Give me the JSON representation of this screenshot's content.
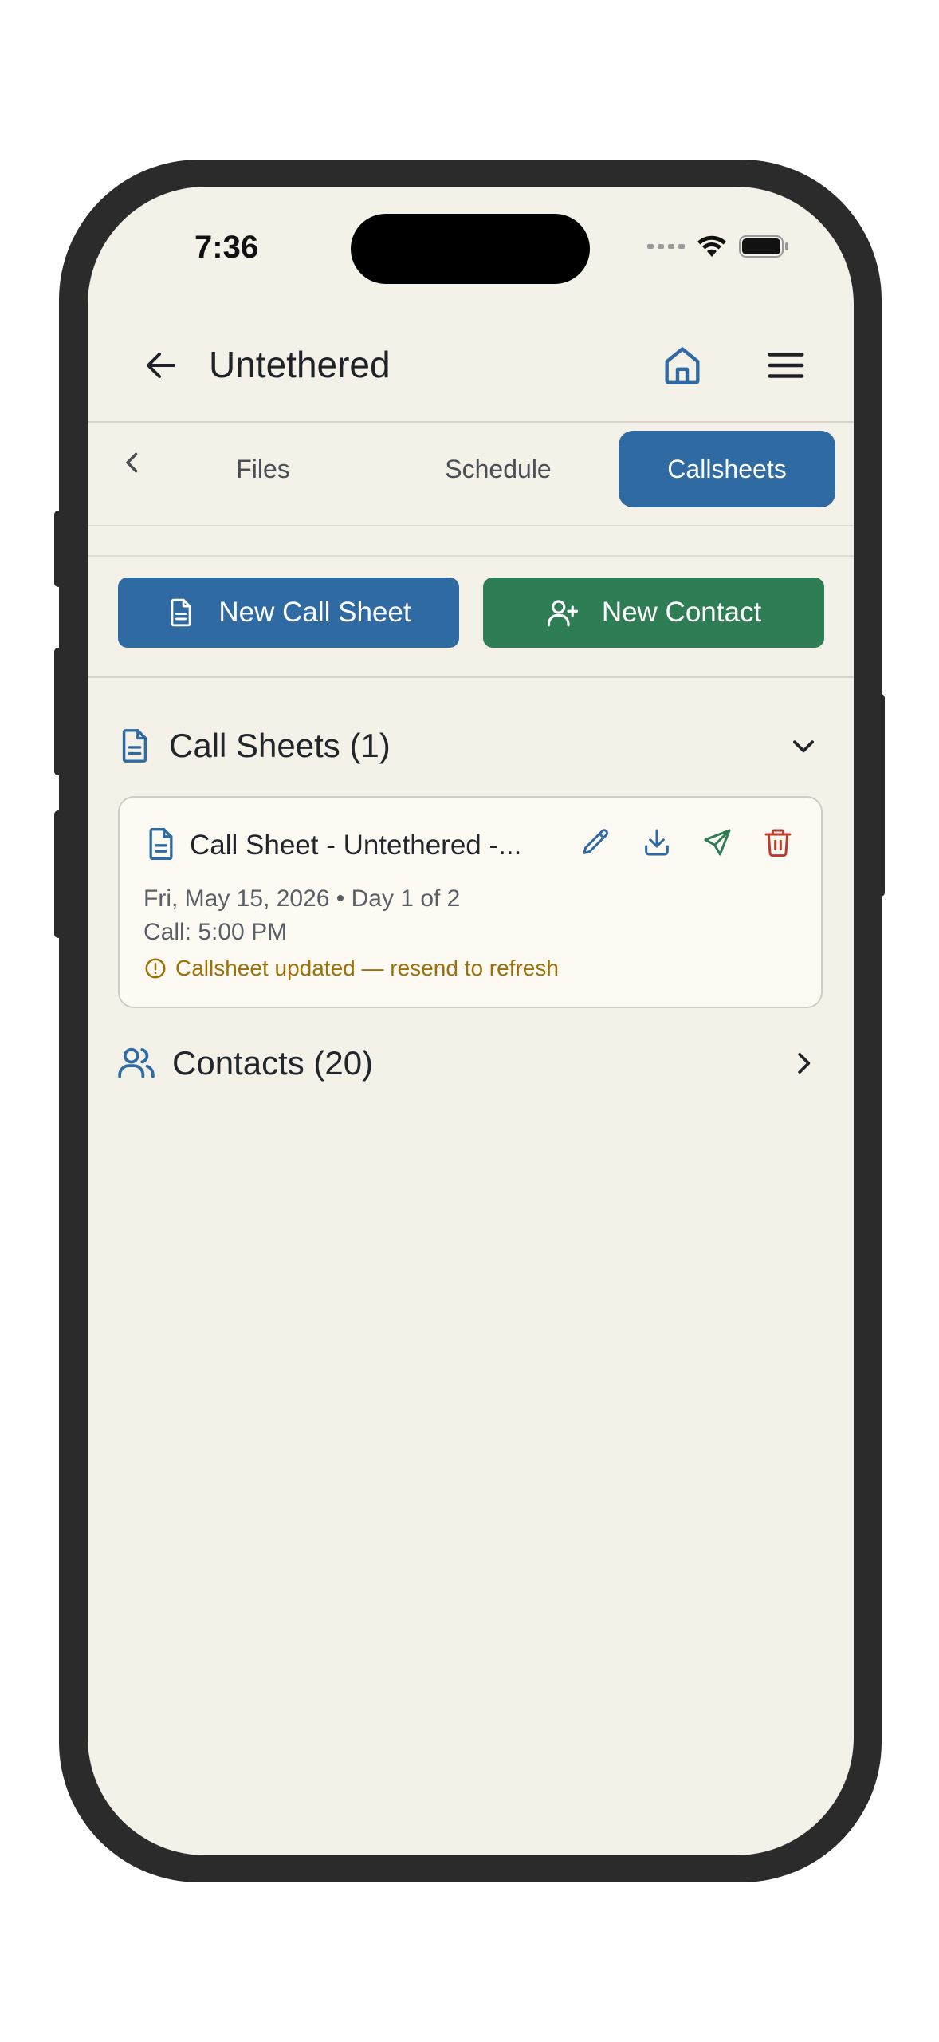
{
  "status_bar": {
    "time": "7:36"
  },
  "app_bar": {
    "title": "Untethered"
  },
  "tabs": [
    {
      "label": "Files"
    },
    {
      "label": "Schedule"
    },
    {
      "label": "Callsheets"
    }
  ],
  "actions": {
    "new_call_sheet": "New Call Sheet",
    "new_contact": "New Contact"
  },
  "call_sheets_section": {
    "title": "Call Sheets (1)",
    "items": [
      {
        "title": "Call Sheet - Untethered -...",
        "date_line": "Fri, May 15, 2026 • Day 1 of 2",
        "call_line": "Call: 5:00 PM",
        "warning": "Callsheet updated — resend to refresh"
      }
    ]
  },
  "contacts_section": {
    "title": "Contacts (20)"
  },
  "colors": {
    "background": "#f3f1e8",
    "primary_blue": "#2f6aa3",
    "primary_green": "#2f7d55",
    "delete_red": "#c0392b",
    "warning": "#a07008"
  }
}
